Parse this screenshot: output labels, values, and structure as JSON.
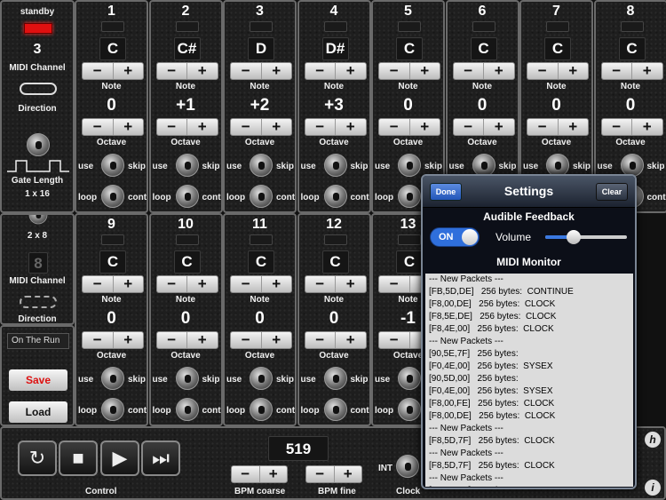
{
  "sidebar": {
    "standby_label": "standby",
    "midi_channel_top": "3",
    "midi_channel_label": "MIDI Channel",
    "direction_label": "Direction",
    "gate_length_label": "Gate Length",
    "gate_opt1": "1 x 16",
    "gate_opt2": "2 x 8",
    "midi_channel_bottom": "8",
    "midi_channel_label2": "MIDI Channel",
    "direction_label2": "Direction",
    "preset_name": "On The Run",
    "save_label": "Save",
    "load_label": "Load"
  },
  "steps_top": [
    {
      "num": "1",
      "note": "C",
      "octave": "0"
    },
    {
      "num": "2",
      "note": "C#",
      "octave": "+1"
    },
    {
      "num": "3",
      "note": "D",
      "octave": "+2"
    },
    {
      "num": "4",
      "note": "D#",
      "octave": "+3"
    },
    {
      "num": "5",
      "note": "C",
      "octave": "0"
    },
    {
      "num": "6",
      "note": "C",
      "octave": "0"
    },
    {
      "num": "7",
      "note": "C",
      "octave": "0"
    },
    {
      "num": "8",
      "note": "C",
      "octave": "0"
    }
  ],
  "steps_bottom": [
    {
      "num": "9",
      "note": "C",
      "octave": "0"
    },
    {
      "num": "10",
      "note": "C",
      "octave": "0"
    },
    {
      "num": "11",
      "note": "C",
      "octave": "0"
    },
    {
      "num": "12",
      "note": "C",
      "octave": "0"
    },
    {
      "num": "13",
      "note": "C",
      "octave": "-1"
    }
  ],
  "step_labels": {
    "note": "Note",
    "octave": "Octave",
    "use": "use",
    "skip": "skip",
    "loop": "loop",
    "cont": "cont",
    "minus": "−",
    "plus": "+"
  },
  "bottom": {
    "control_label": "Control",
    "bpm": "519",
    "bpm_coarse": "BPM coarse",
    "bpm_fine": "BPM fine",
    "int_label": "INT",
    "clock_label": "Clock"
  },
  "settings": {
    "title": "Settings",
    "done_label": "Done",
    "clear_label": "Clear",
    "audible_feedback": "Audible Feedback",
    "toggle_state": "ON",
    "volume_label": "Volume",
    "volume_level": 0.35,
    "monitor_title": "MIDI Monitor",
    "monitor_lines": [
      "--- New Packets ---",
      "[FB,5D,DE]   256 bytes:  CONTINUE",
      "[F8,00,DE]   256 bytes:  CLOCK",
      "[F8,5E,DE]   256 bytes:  CLOCK",
      "[F8,4E,00]   256 bytes:  CLOCK",
      "--- New Packets ---",
      "[90,5E,7F]   256 bytes:",
      "[F0,4E,00]   256 bytes:  SYSEX",
      "[90,5D,00]   256 bytes:",
      "[F0,4E,00]   256 bytes:  SYSEX",
      "[F8,00,FE]   256 bytes:  CLOCK",
      "[F8,00,DE]   256 bytes:  CLOCK",
      "--- New Packets ---",
      "[F8,5D,7F]   256 bytes:  CLOCK",
      "--- New Packets ---",
      "[F8,5D,7F]   256 bytes:  CLOCK",
      "--- New Packets ---",
      "[F8,5D,7F]   256 bytes:  CLOCK"
    ]
  }
}
